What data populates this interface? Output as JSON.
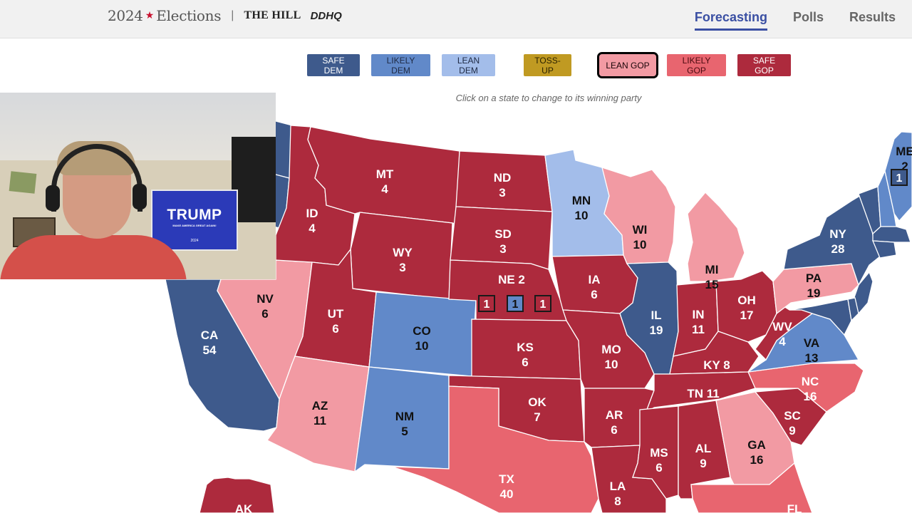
{
  "header": {
    "title_prefix": "2024",
    "title_suffix": "Elections",
    "star_icon": "star-icon",
    "separator": "|",
    "publisher": "THE HILL",
    "partner": "DDHQ",
    "nav": [
      {
        "label": "Forecasting",
        "active": true
      },
      {
        "label": "Polls",
        "active": false
      },
      {
        "label": "Results",
        "active": false
      }
    ]
  },
  "legend": {
    "ratings": [
      {
        "key": "safe_dem",
        "label": "SAFE DEM",
        "color": "#3e5a8c",
        "text_color": "#ffffff",
        "selected": false
      },
      {
        "key": "likely_dem",
        "label": "LIKELY DEM",
        "color": "#6189c9",
        "text_color": "#1f2a44",
        "selected": false
      },
      {
        "key": "lean_dem",
        "label": "LEAN DEM",
        "color": "#a3bdea",
        "text_color": "#1f2a44",
        "selected": false
      },
      {
        "key": "tossup",
        "label": "TOSS-UP",
        "color": "#c09a22",
        "text_color": "#2a2200",
        "selected": false
      },
      {
        "key": "lean_gop",
        "label": "LEAN GOP",
        "color": "#f29aa3",
        "text_color": "#1a0508",
        "selected": true
      },
      {
        "key": "likely_gop",
        "label": "LIKELY GOP",
        "color": "#e8656f",
        "text_color": "#4a0a10",
        "selected": false
      },
      {
        "key": "safe_gop",
        "label": "SAFE GOP",
        "color": "#ad2a3d",
        "text_color": "#ffffff",
        "selected": false
      }
    ],
    "hint": "Click on a state to change to its winning party"
  },
  "colors": {
    "safe_dem": "#3e5a8c",
    "likely_dem": "#6189c9",
    "lean_dem": "#a3bdea",
    "tossup": "#c09a22",
    "lean_gop": "#f29aa3",
    "likely_gop": "#e8656f",
    "safe_gop": "#ad2a3d"
  },
  "states": [
    {
      "abbr": "WA",
      "ev": null,
      "rating": "safe_dem",
      "label": false
    },
    {
      "abbr": "OR",
      "ev": null,
      "rating": "safe_dem",
      "label": false
    },
    {
      "abbr": "CA",
      "ev": 54,
      "rating": "safe_dem"
    },
    {
      "abbr": "NV",
      "ev": 6,
      "rating": "lean_gop"
    },
    {
      "abbr": "ID",
      "ev": 4,
      "rating": "safe_gop"
    },
    {
      "abbr": "MT",
      "ev": 4,
      "rating": "safe_gop"
    },
    {
      "abbr": "WY",
      "ev": 3,
      "rating": "safe_gop"
    },
    {
      "abbr": "UT",
      "ev": 6,
      "rating": "safe_gop"
    },
    {
      "abbr": "AZ",
      "ev": 11,
      "rating": "lean_gop"
    },
    {
      "abbr": "CO",
      "ev": 10,
      "rating": "likely_dem"
    },
    {
      "abbr": "NM",
      "ev": 5,
      "rating": "likely_dem"
    },
    {
      "abbr": "ND",
      "ev": 3,
      "rating": "safe_gop"
    },
    {
      "abbr": "SD",
      "ev": 3,
      "rating": "safe_gop"
    },
    {
      "abbr": "NE",
      "ev": 2,
      "rating": "safe_gop"
    },
    {
      "abbr": "KS",
      "ev": 6,
      "rating": "safe_gop"
    },
    {
      "abbr": "OK",
      "ev": 7,
      "rating": "safe_gop"
    },
    {
      "abbr": "TX",
      "ev": 40,
      "rating": "likely_gop"
    },
    {
      "abbr": "MN",
      "ev": 10,
      "rating": "lean_dem"
    },
    {
      "abbr": "IA",
      "ev": 6,
      "rating": "safe_gop"
    },
    {
      "abbr": "MO",
      "ev": 10,
      "rating": "safe_gop"
    },
    {
      "abbr": "AR",
      "ev": 6,
      "rating": "safe_gop"
    },
    {
      "abbr": "LA",
      "ev": 8,
      "rating": "safe_gop"
    },
    {
      "abbr": "WI",
      "ev": 10,
      "rating": "lean_gop"
    },
    {
      "abbr": "IL",
      "ev": 19,
      "rating": "safe_dem"
    },
    {
      "abbr": "MI",
      "ev": 15,
      "rating": "lean_gop"
    },
    {
      "abbr": "IN",
      "ev": 11,
      "rating": "safe_gop"
    },
    {
      "abbr": "OH",
      "ev": 17,
      "rating": "safe_gop"
    },
    {
      "abbr": "KY",
      "ev": 8,
      "rating": "safe_gop"
    },
    {
      "abbr": "TN",
      "ev": 11,
      "rating": "safe_gop"
    },
    {
      "abbr": "MS",
      "ev": 6,
      "rating": "safe_gop"
    },
    {
      "abbr": "AL",
      "ev": 9,
      "rating": "safe_gop"
    },
    {
      "abbr": "GA",
      "ev": 16,
      "rating": "lean_gop"
    },
    {
      "abbr": "FL",
      "ev": null,
      "rating": "likely_gop",
      "label_text": "FL"
    },
    {
      "abbr": "SC",
      "ev": 9,
      "rating": "safe_gop"
    },
    {
      "abbr": "NC",
      "ev": 16,
      "rating": "likely_gop"
    },
    {
      "abbr": "VA",
      "ev": 13,
      "rating": "likely_dem"
    },
    {
      "abbr": "WV",
      "ev": 4,
      "rating": "safe_gop"
    },
    {
      "abbr": "PA",
      "ev": 19,
      "rating": "lean_gop"
    },
    {
      "abbr": "NY",
      "ev": 28,
      "rating": "safe_dem"
    },
    {
      "abbr": "NJ",
      "ev": null,
      "rating": "safe_dem",
      "label": false
    },
    {
      "abbr": "MD",
      "ev": null,
      "rating": "safe_dem",
      "label": false
    },
    {
      "abbr": "DE",
      "ev": null,
      "rating": "safe_dem",
      "label": false
    },
    {
      "abbr": "VT",
      "ev": null,
      "rating": "safe_dem",
      "label": false
    },
    {
      "abbr": "NH",
      "ev": null,
      "rating": "likely_dem",
      "label": false
    },
    {
      "abbr": "MA",
      "ev": null,
      "rating": "safe_dem",
      "label": false
    },
    {
      "abbr": "CT",
      "ev": null,
      "rating": "safe_dem",
      "label": false
    },
    {
      "abbr": "ME",
      "ev": 2,
      "rating": "likely_dem",
      "label_text": "ME"
    },
    {
      "abbr": "AK",
      "ev": null,
      "rating": "safe_gop",
      "label_text": "AK"
    }
  ],
  "districts": [
    {
      "id": "NE-1",
      "ev": 1,
      "rating": "safe_gop"
    },
    {
      "id": "NE-2",
      "ev": 1,
      "rating": "likely_dem"
    },
    {
      "id": "NE-3",
      "ev": 1,
      "rating": "safe_gop"
    },
    {
      "id": "ME-2",
      "ev": 1,
      "rating": "safe_dem"
    }
  ],
  "webcam": {
    "sign_text": "TRUMP",
    "sign_slogan": "MAKE AMERICA GREAT AGAIN!",
    "sign_year": "2024"
  }
}
